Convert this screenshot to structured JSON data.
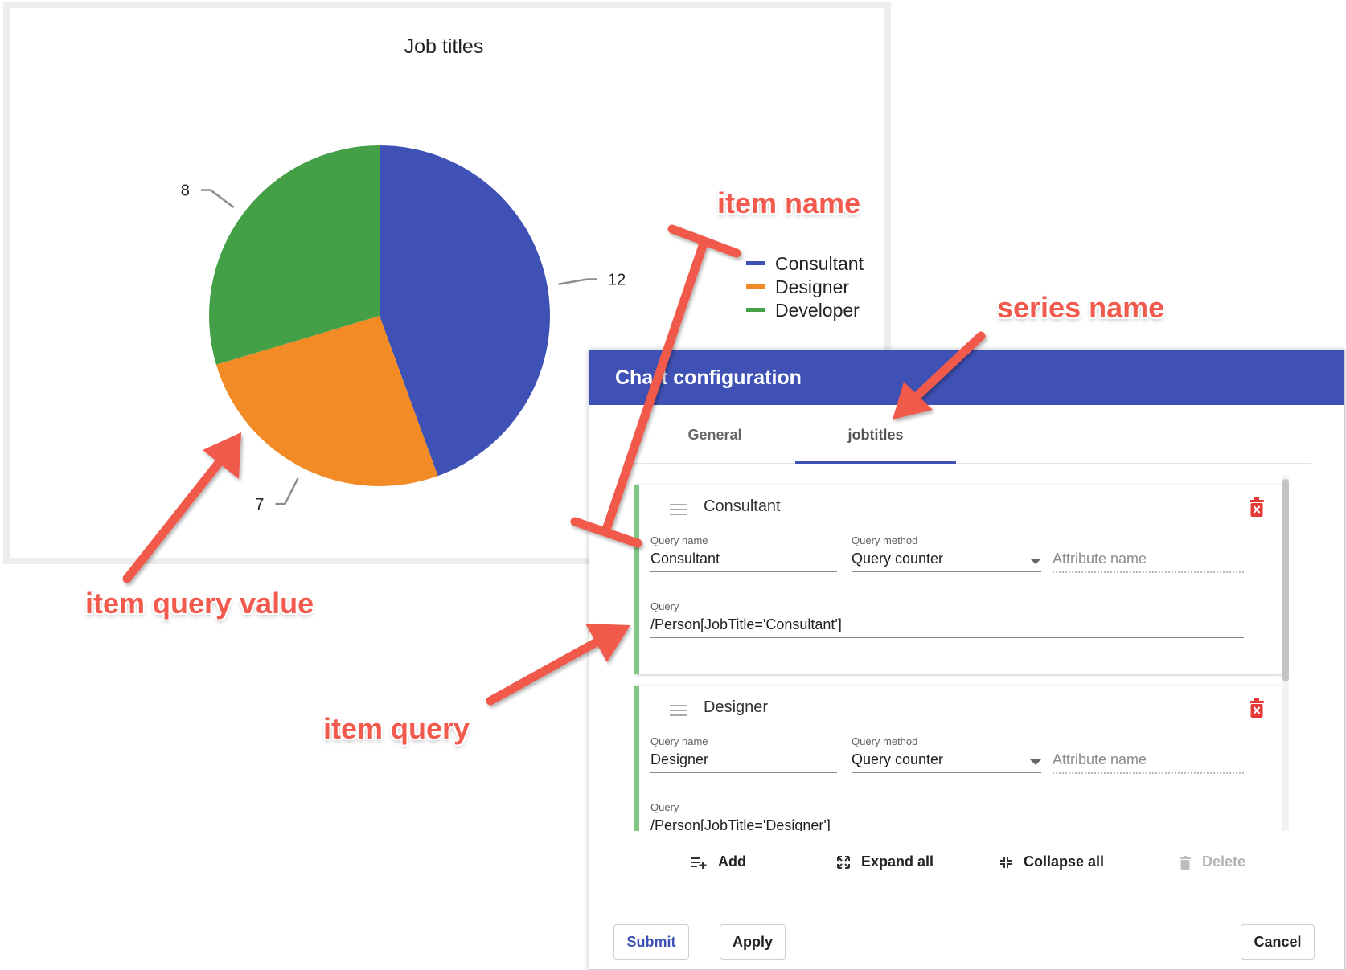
{
  "chart": {
    "title": "Job titles",
    "chart_data": {
      "type": "pie",
      "title": "Job titles",
      "categories": [
        "Consultant",
        "Designer",
        "Developer"
      ],
      "values": [
        12,
        7,
        8
      ],
      "colors": [
        "#3f51b5",
        "#f28b26",
        "#43a047"
      ],
      "legend_position": "right"
    }
  },
  "dialog": {
    "title": "Chart configuration",
    "tabs": [
      {
        "label": "General",
        "active": false
      },
      {
        "label": "jobtitles",
        "active": true
      }
    ],
    "items": [
      {
        "title": "Consultant",
        "query_name_label": "Query name",
        "query_name_value": "Consultant",
        "query_method_label": "Query method",
        "query_method_value": "Query counter",
        "attribute_placeholder": "Attribute name",
        "query_label": "Query",
        "query_value": "/Person[JobTitle='Consultant']"
      },
      {
        "title": "Designer",
        "query_name_label": "Query name",
        "query_name_value": "Designer",
        "query_method_label": "Query method",
        "query_method_value": "Query counter",
        "attribute_placeholder": "Attribute name",
        "query_label": "Query",
        "query_value": "/Person[JobTitle='Designer']"
      }
    ],
    "toolbar": {
      "add_label": "Add",
      "expand_label": "Expand all",
      "collapse_label": "Collapse all",
      "delete_label": "Delete"
    },
    "footer": {
      "submit_label": "Submit",
      "apply_label": "Apply",
      "cancel_label": "Cancel"
    },
    "accent_color": "#3f51b5",
    "item_border_color": "#81c784",
    "delete_icon_color": "#e53935"
  },
  "annotations": {
    "item_name": "item name",
    "series_name": "series name",
    "item_query_value": "item query value",
    "item_query": "item query",
    "color": "#f15a4c"
  }
}
